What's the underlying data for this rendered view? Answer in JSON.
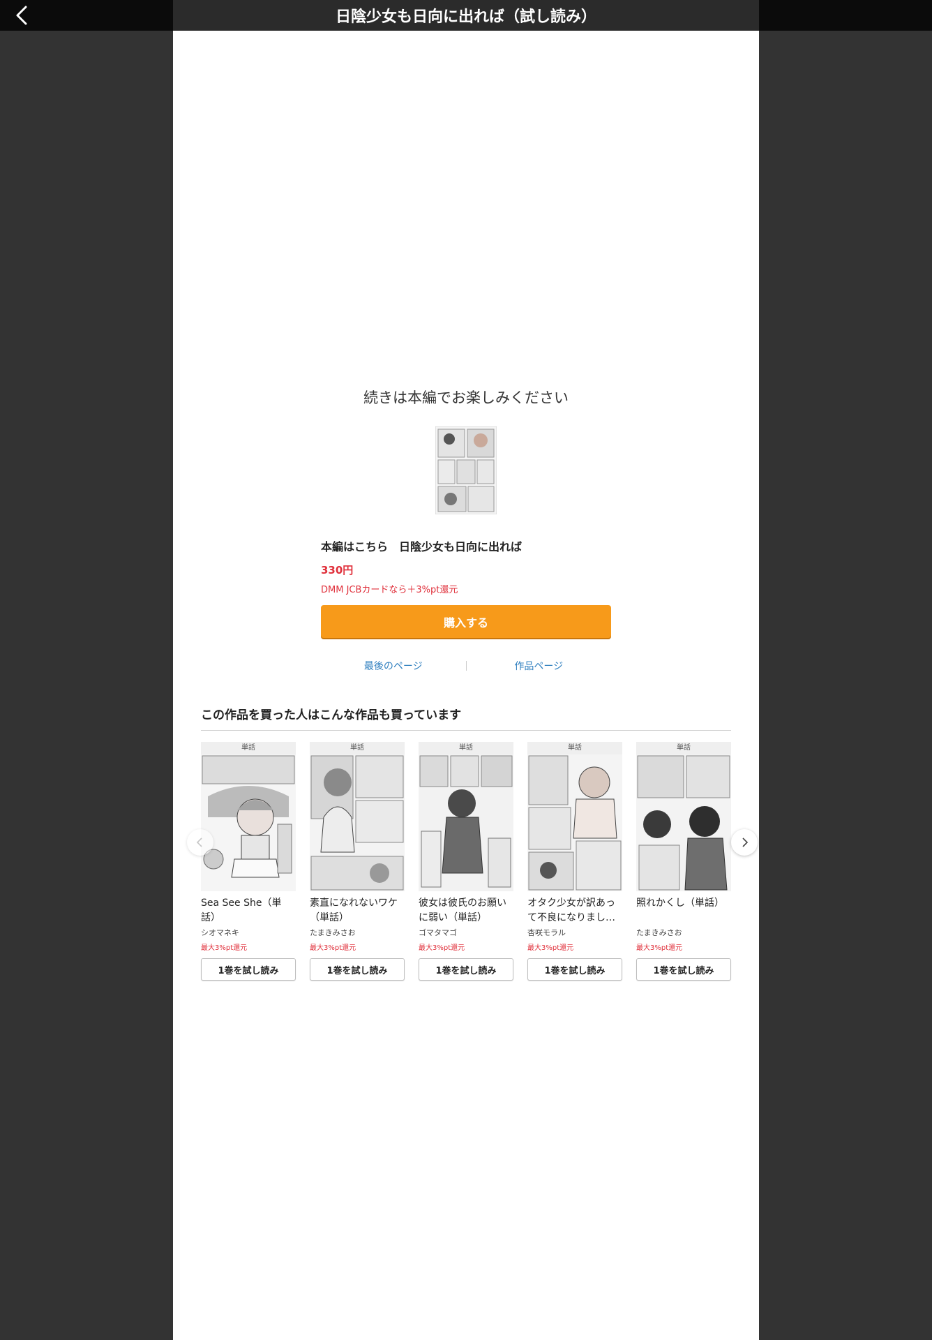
{
  "header": {
    "title": "日陰少女も日向に出れば（試し読み）",
    "back_icon": "chevron-left-icon"
  },
  "end_screen": {
    "message": "続きは本編でお楽しみください",
    "main_title": "本編はこちら　日陰少女も日向に出れば",
    "price": "330円",
    "point_note": "DMM JCBカードなら＋3%pt還元",
    "buy_label": "購入する",
    "last_page_link": "最後のページ",
    "work_page_link": "作品ページ"
  },
  "recommend": {
    "title": "この作品を買った人はこんな作品も買っています",
    "items": [
      {
        "badge": "単話",
        "title": "Sea See She（単話）",
        "author": "シオマネキ",
        "pt": "最大3%pt還元",
        "trial": "1巻を試し読み"
      },
      {
        "badge": "単話",
        "title": "素直になれないワケ（単話）",
        "author": "たまきみさお",
        "pt": "最大3%pt還元",
        "trial": "1巻を試し読み"
      },
      {
        "badge": "単話",
        "title": "彼女は彼氏のお願いに弱い（単話）",
        "author": "ゴマタマゴ",
        "pt": "最大3%pt還元",
        "trial": "1巻を試し読み"
      },
      {
        "badge": "単話",
        "title": "オタク少女が訳あって不良になりまし…",
        "author": "杏咲モラル",
        "pt": "最大3%pt還元",
        "trial": "1巻を試し読み"
      },
      {
        "badge": "単話",
        "title": "照れかくし（単話）",
        "author": "たまきみさお",
        "pt": "最大3%pt還元",
        "trial": "1巻を試し読み"
      }
    ]
  },
  "colors": {
    "orange": "#f79a1a",
    "price_red": "#e0303b",
    "link_blue": "#2f7fbf"
  }
}
